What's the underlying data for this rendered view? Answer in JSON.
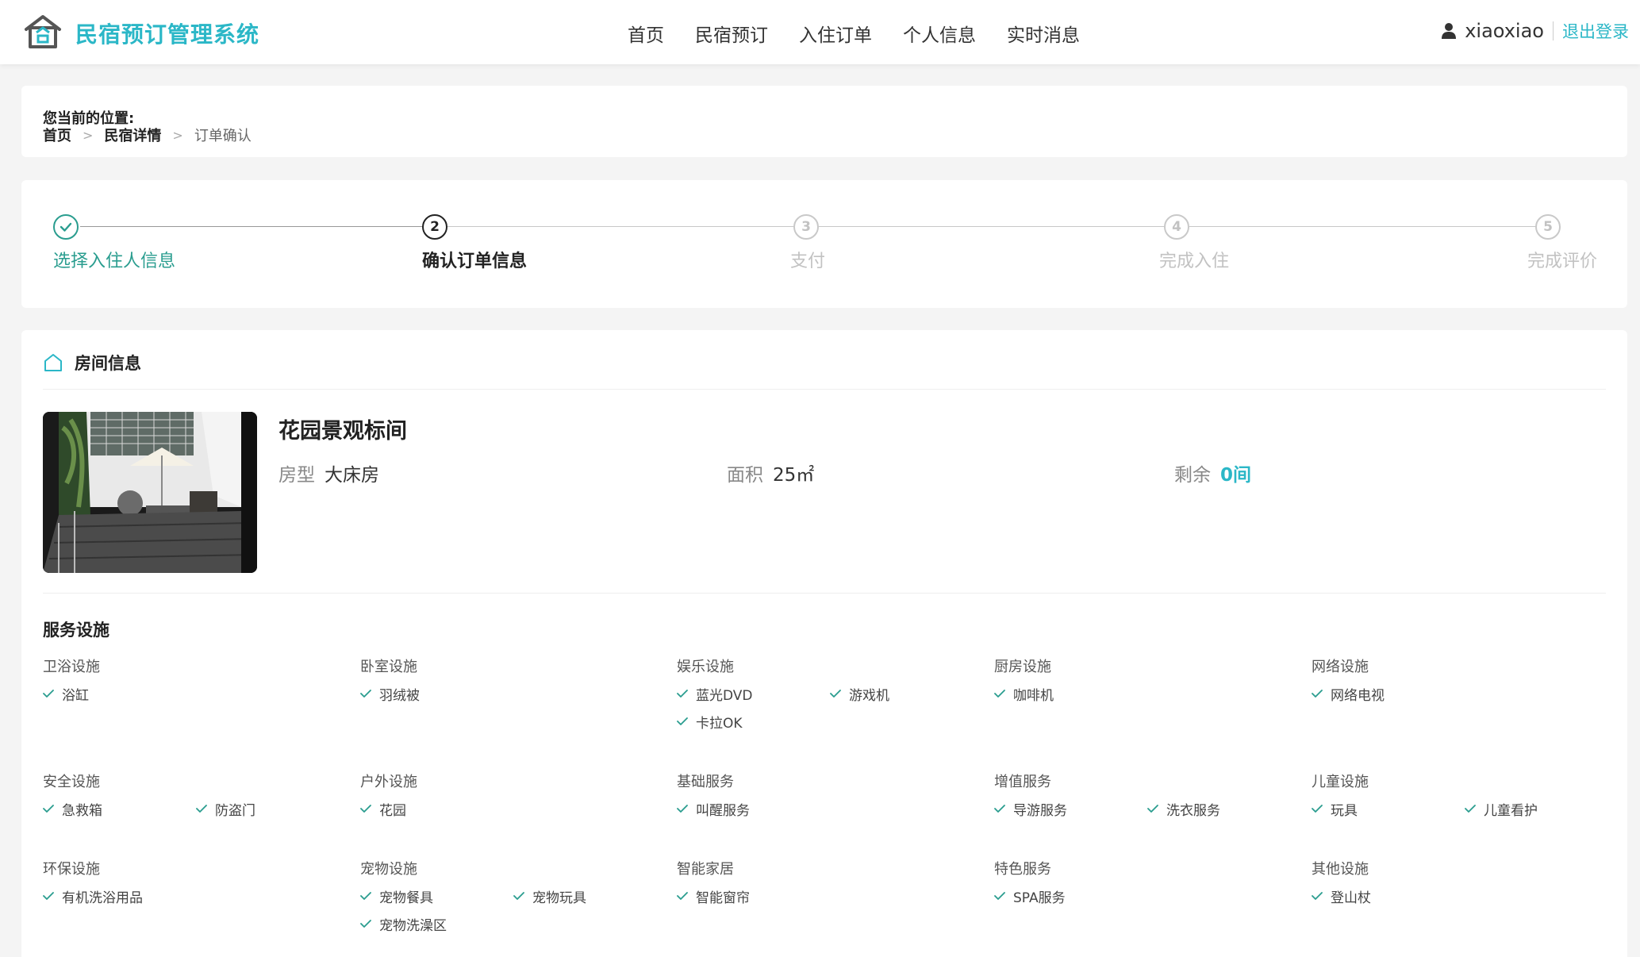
{
  "header": {
    "app_title": "民宿预订管理系统",
    "nav": [
      "首页",
      "民宿预订",
      "入住订单",
      "个人信息",
      "实时消息"
    ],
    "username": "xiaoxiao",
    "logout": "退出登录",
    "accent_color": "#2bb7c7"
  },
  "breadcrumb": {
    "label": "您当前的位置:",
    "items": [
      "首页",
      "民宿详情",
      "订单确认"
    ]
  },
  "steps": [
    {
      "number": "1",
      "label": "选择入住人信息",
      "state": "done"
    },
    {
      "number": "2",
      "label": "确认订单信息",
      "state": "active"
    },
    {
      "number": "3",
      "label": "支付",
      "state": "pending"
    },
    {
      "number": "4",
      "label": "完成入住",
      "state": "pending"
    },
    {
      "number": "5",
      "label": "完成评价",
      "state": "pending"
    }
  ],
  "room": {
    "section_title": "房间信息",
    "name": "花园景观标间",
    "type_label": "房型",
    "type_value": "大床房",
    "area_label": "面积",
    "area_value": "25㎡",
    "remain_label": "剩余",
    "remain_value": "0间"
  },
  "services": {
    "title": "服务设施",
    "groups": [
      {
        "name": "卫浴设施",
        "items": [
          "浴缸"
        ]
      },
      {
        "name": "卧室设施",
        "items": [
          "羽绒被"
        ]
      },
      {
        "name": "娱乐设施",
        "items": [
          "蓝光DVD",
          "游戏机",
          "卡拉OK"
        ]
      },
      {
        "name": "厨房设施",
        "items": [
          "咖啡机"
        ]
      },
      {
        "name": "网络设施",
        "items": [
          "网络电视"
        ]
      },
      {
        "name": "安全设施",
        "items": [
          "急救箱",
          "防盗门"
        ]
      },
      {
        "name": "户外设施",
        "items": [
          "花园"
        ]
      },
      {
        "name": "基础服务",
        "items": [
          "叫醒服务"
        ]
      },
      {
        "name": "增值服务",
        "items": [
          "导游服务",
          "洗衣服务"
        ]
      },
      {
        "name": "儿童设施",
        "items": [
          "玩具",
          "儿童看护"
        ]
      },
      {
        "name": "环保设施",
        "items": [
          "有机洗浴用品"
        ]
      },
      {
        "name": "宠物设施",
        "items": [
          "宠物餐具",
          "宠物玩具",
          "宠物洗澡区"
        ]
      },
      {
        "name": "智能家居",
        "items": [
          "智能窗帘"
        ]
      },
      {
        "name": "特色服务",
        "items": [
          "SPA服务"
        ]
      },
      {
        "name": "其他设施",
        "items": [
          "登山杖"
        ]
      }
    ]
  }
}
